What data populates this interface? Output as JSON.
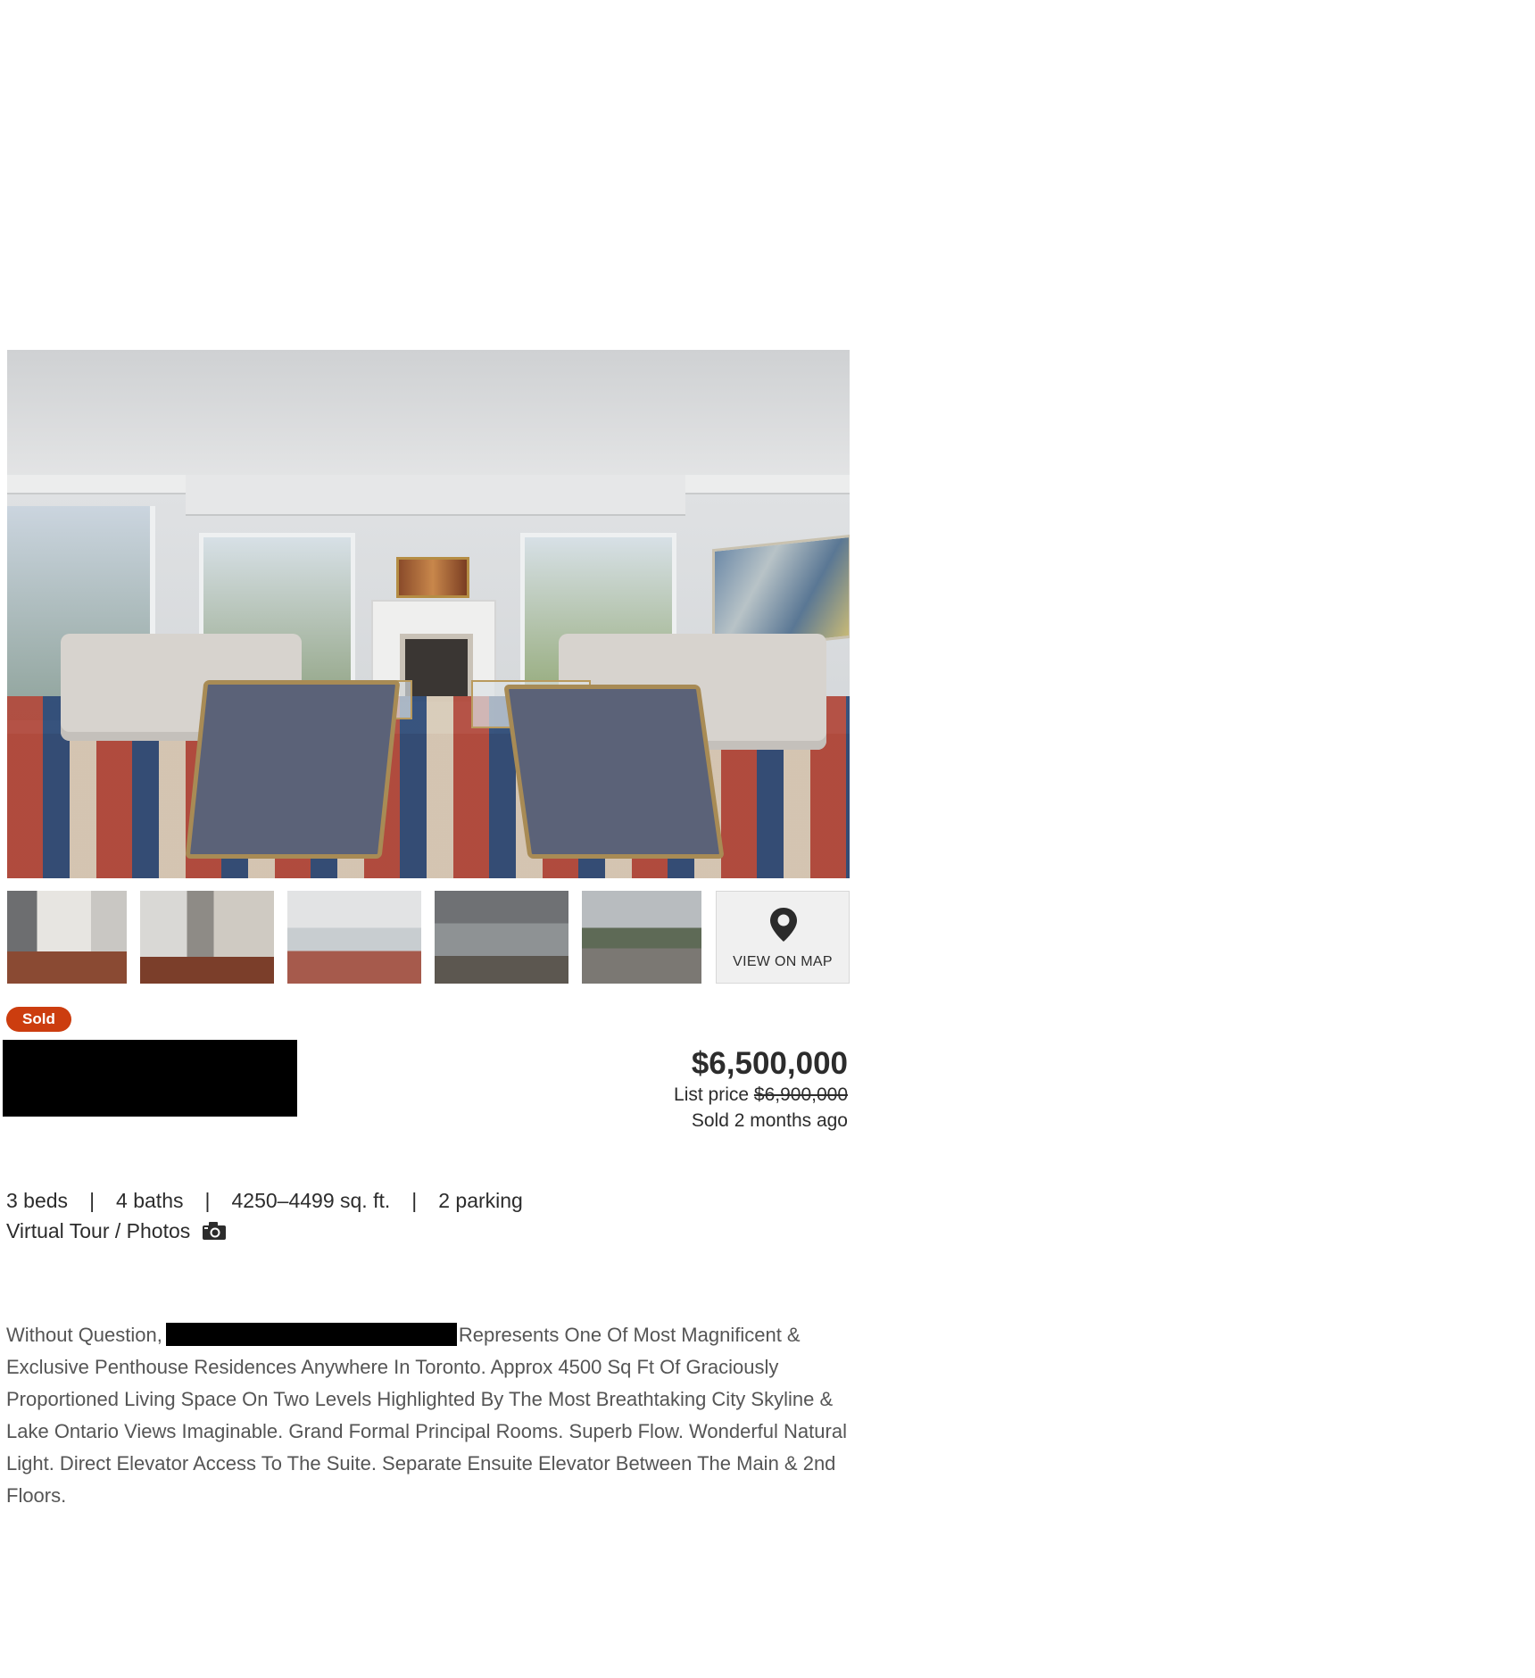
{
  "gallery": {
    "main_photo": "living-room-photo",
    "thumbnails": [
      "hallway-photo",
      "staircase-photo",
      "living-room-photo",
      "living-room-photo",
      "terrace-photo"
    ],
    "map_tile": {
      "label": "VIEW ON MAP",
      "icon": "map-pin-icon"
    }
  },
  "listing": {
    "status_badge": "Sold",
    "status_color": "#cc3d0f",
    "sale_price": "$6,500,000",
    "list_price_label": "List price",
    "list_price_value": "$6,900,000",
    "sold_when": "Sold 2 months ago"
  },
  "specs": {
    "beds": "3 beds",
    "baths": "4 baths",
    "sqft": "4250–4499 sq. ft.",
    "parking": "2 parking",
    "separator": "|",
    "tour_label": "Virtual Tour / Photos",
    "tour_icon": "camera-icon"
  },
  "description": {
    "before_redaction": "Without Question,",
    "after_redaction": "Represents One Of Most Magnificent & Exclusive Penthouse Residences Anywhere In Toronto. Approx 4500 Sq Ft Of Graciously Proportioned Living Space On Two Levels Highlighted By The Most Breathtaking City Skyline & Lake Ontario Views Imaginable. Grand Formal Principal Rooms. Superb Flow. Wonderful Natural Light. Direct Elevator Access To The Suite. Separate Ensuite Elevator Between The Main & 2nd Floors."
  }
}
